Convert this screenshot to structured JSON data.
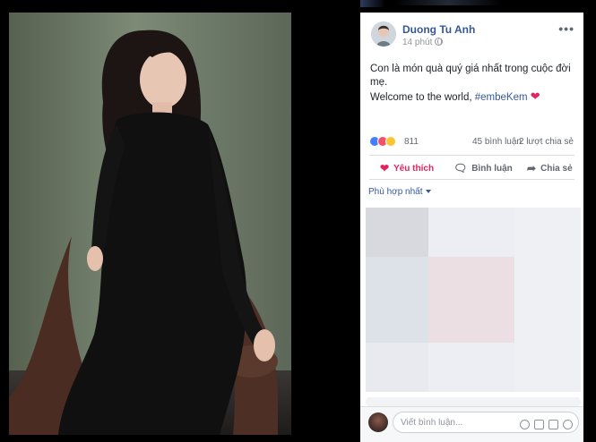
{
  "post": {
    "author": "Duong Tu Anh",
    "timestamp": "14 phút",
    "text_line1": "Con là món quà quý giá nhất trong cuộc đời mẹ.",
    "text_line2_prefix": "Welcome to the world, ",
    "hashtag": "#embeKem",
    "heart": "❤"
  },
  "stats": {
    "reactions": "811",
    "comments": "45 bình luận",
    "shares": "2 lượt chia sẻ",
    "reaction_icons": [
      "like-icon",
      "love-icon",
      "wow-icon"
    ]
  },
  "actions": {
    "like": "Yêu thích",
    "comment": "Bình luận",
    "share": "Chia sẻ"
  },
  "comments": {
    "sort_label": "Phù hợp nhất",
    "placeholder": "Viết bình luận..."
  },
  "colors": {
    "link": "#365899",
    "love": "#e0245e",
    "background": "#000000"
  }
}
